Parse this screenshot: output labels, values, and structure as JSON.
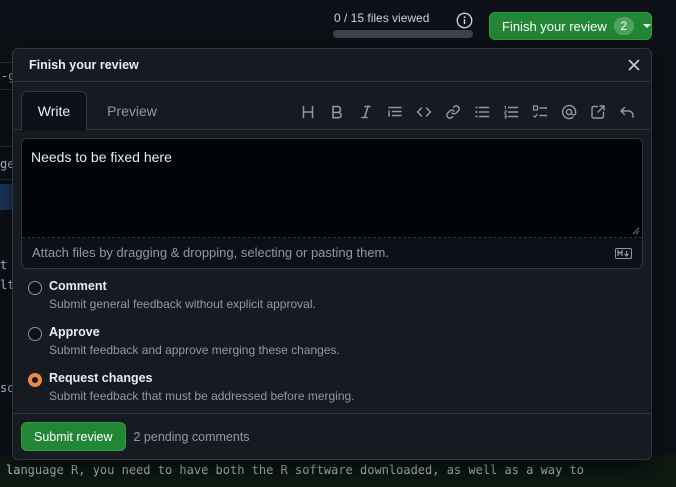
{
  "background": {
    "fragments": [
      {
        "id": "frag-g",
        "text": "-g"
      },
      {
        "id": "frag-ge",
        "text": "ge"
      },
      {
        "id": "frag-t",
        "text": "t"
      },
      {
        "id": "frag-lt",
        "text": "lt"
      },
      {
        "id": "frag-so",
        "text": "so"
      },
      {
        "id": "frag-line1",
        "text": "language R, you need to have both the R software downloaded, as well as a way to"
      }
    ]
  },
  "header": {
    "files_viewed": "0 / 15 files viewed",
    "files_viewed_fraction": 0,
    "finish_button_label": "Finish your review",
    "pending_count": "2",
    "accent_color": "#238636"
  },
  "dialog": {
    "title": "Finish your review",
    "close_icon": "close-icon",
    "tabs": [
      {
        "label": "Write",
        "selected": true
      },
      {
        "label": "Preview",
        "selected": false
      }
    ],
    "toolbar_icons": [
      "heading-icon",
      "bold-icon",
      "italic-icon",
      "quote-icon",
      "code-icon",
      "link-icon",
      "unordered-list-icon",
      "ordered-list-icon",
      "task-list-icon",
      "mention-icon",
      "cross-reference-icon",
      "undo-icon"
    ],
    "comment_text": "Needs to be fixed here",
    "attach_hint": "Attach files by dragging & dropping, selecting or pasting them.",
    "options": [
      {
        "label": "Comment",
        "description": "Submit general feedback without explicit approval.",
        "checked": false
      },
      {
        "label": "Approve",
        "description": "Submit feedback and approve merging these changes.",
        "checked": false
      },
      {
        "label": "Request changes",
        "description": "Submit feedback that must be addressed before merging.",
        "checked": true
      }
    ],
    "submit_label": "Submit review",
    "pending_comments": "2 pending comments"
  }
}
